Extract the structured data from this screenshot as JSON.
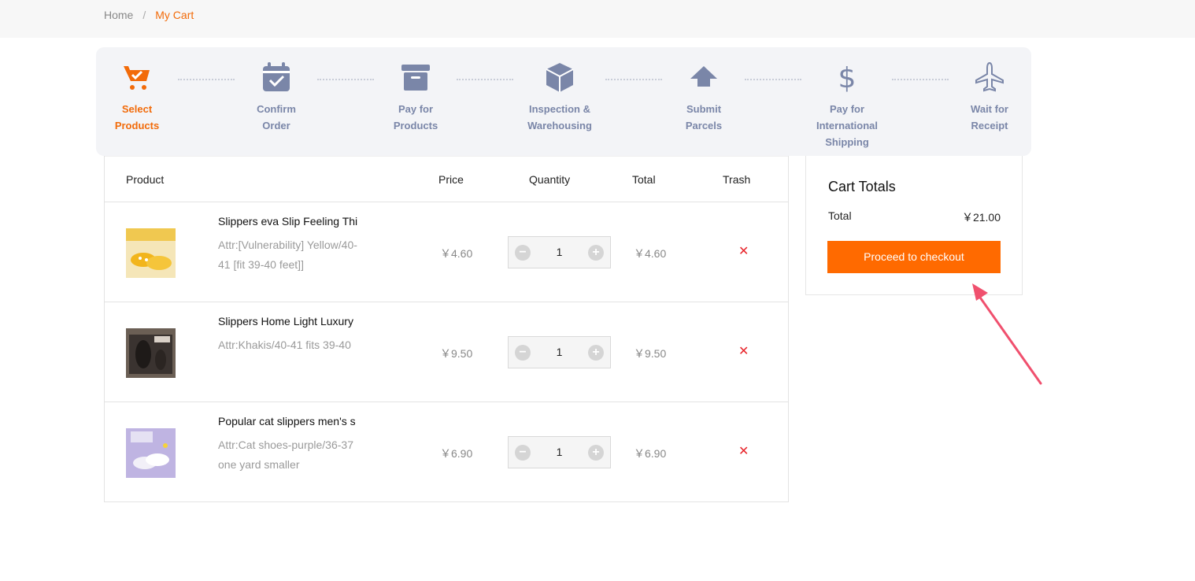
{
  "breadcrumb": {
    "home": "Home",
    "separator": "/",
    "current": "My Cart"
  },
  "steps": [
    {
      "lines": [
        "Select",
        "Products"
      ],
      "icon": "cart-icon",
      "active": true
    },
    {
      "lines": [
        "Confirm",
        "Order"
      ],
      "icon": "calendar-check-icon",
      "active": false
    },
    {
      "lines": [
        "Pay for",
        "Products"
      ],
      "icon": "archive-box-icon",
      "active": false
    },
    {
      "lines": [
        "Inspection &",
        "Warehousing"
      ],
      "icon": "package-icon",
      "active": false
    },
    {
      "lines": [
        "Submit",
        "Parcels"
      ],
      "icon": "upload-arrow-icon",
      "active": false
    },
    {
      "lines": [
        "Pay for",
        "International",
        "Shipping"
      ],
      "icon": "dollar-icon",
      "active": false
    },
    {
      "lines": [
        "Wait for",
        "Receipt"
      ],
      "icon": "airplane-icon",
      "active": false
    }
  ],
  "table": {
    "headers": {
      "product": "Product",
      "price": "Price",
      "quantity": "Quantity",
      "total": "Total",
      "trash": "Trash"
    },
    "rows": [
      {
        "name": "Slippers eva Slip Feeling Thi",
        "attr": "Attr:[Vulnerability] Yellow/40-41 [fit 39-40 feet]]",
        "price": "￥4.60",
        "qty": "1",
        "total": "￥4.60",
        "thumb_color": "#f0c850"
      },
      {
        "name": "Slippers Home Light Luxury",
        "attr": "Attr:Khakis/40-41 fits 39-40",
        "price": "￥9.50",
        "qty": "1",
        "total": "￥9.50",
        "thumb_color": "#6b5f55"
      },
      {
        "name": "Popular cat slippers men's s",
        "attr": "Attr:Cat shoes-purple/36-37 one yard smaller",
        "price": "￥6.90",
        "qty": "1",
        "total": "￥6.90",
        "thumb_color": "#bfb4e2"
      }
    ],
    "minus": "−",
    "plus": "+",
    "remove": "✕"
  },
  "totals": {
    "title": "Cart Totals",
    "label": "Total",
    "value": "￥21.00",
    "checkout": "Proceed to checkout"
  },
  "colors": {
    "accent": "#f26b0a",
    "button": "#ff6a00",
    "step": "#7a86a8",
    "remove": "#e8262c",
    "annotation": "#f0506e"
  }
}
